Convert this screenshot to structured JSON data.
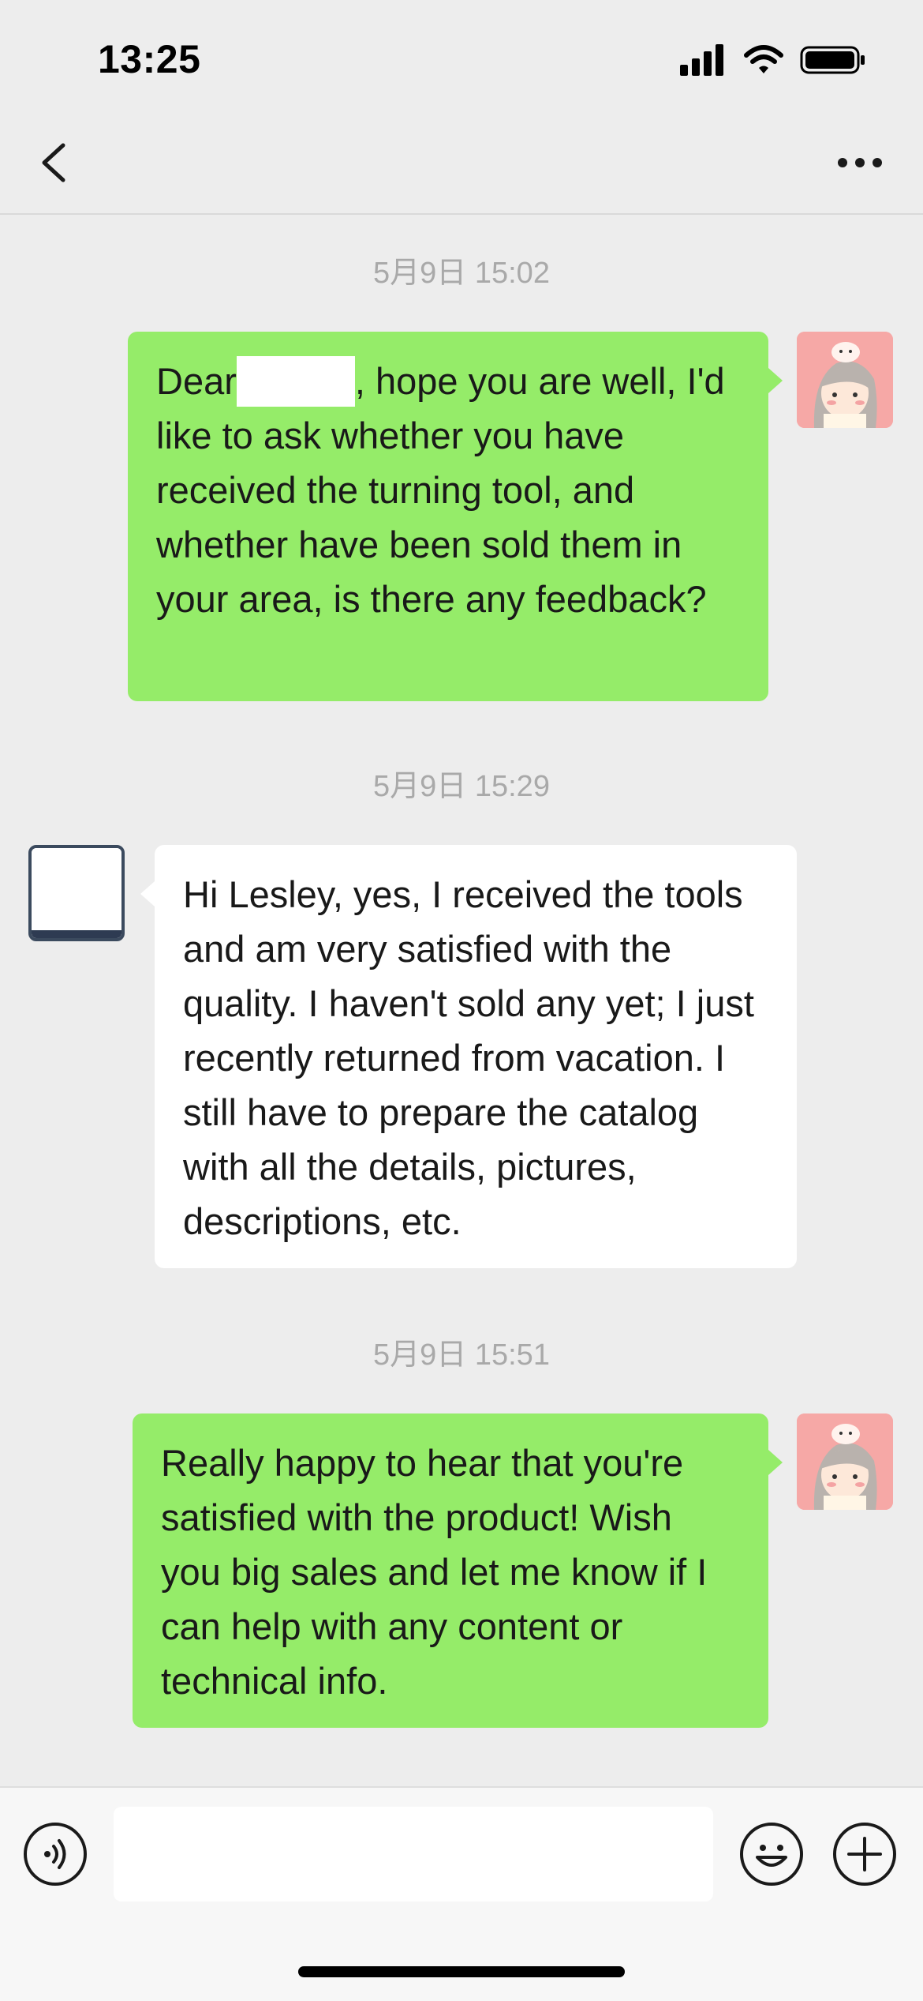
{
  "status_bar": {
    "time": "13:25"
  },
  "nav": {
    "back_icon": "chevron-left-icon",
    "more_icon": "more-dots-icon"
  },
  "messages": [
    {
      "timestamp": "5月9日 15:02",
      "direction": "outgoing",
      "text_before": "Dear",
      "text_after": ", hope you are well, I'd like to ask whether you have received the turning tool, and whether have been sold them in your area, is there any feedback?"
    },
    {
      "timestamp": "5月9日 15:29",
      "direction": "incoming",
      "text": "Hi Lesley, yes, I received the tools and am very satisfied with the quality. I haven't sold any yet; I just recently returned from vacation. I still have to prepare the catalog with all the details, pictures, descriptions, etc."
    },
    {
      "timestamp": "5月9日 15:51",
      "direction": "outgoing",
      "text": "Really happy to hear that you're satisfied with the product! Wish you big sales and let me know if I can help with any content or technical info."
    }
  ],
  "input_bar": {
    "voice_icon": "voice-icon",
    "emoji_icon": "emoji-icon",
    "plus_icon": "plus-icon",
    "draft": ""
  },
  "colors": {
    "outgoing_bubble": "#95ec69",
    "incoming_bubble": "#ffffff",
    "background": "#ededed"
  }
}
